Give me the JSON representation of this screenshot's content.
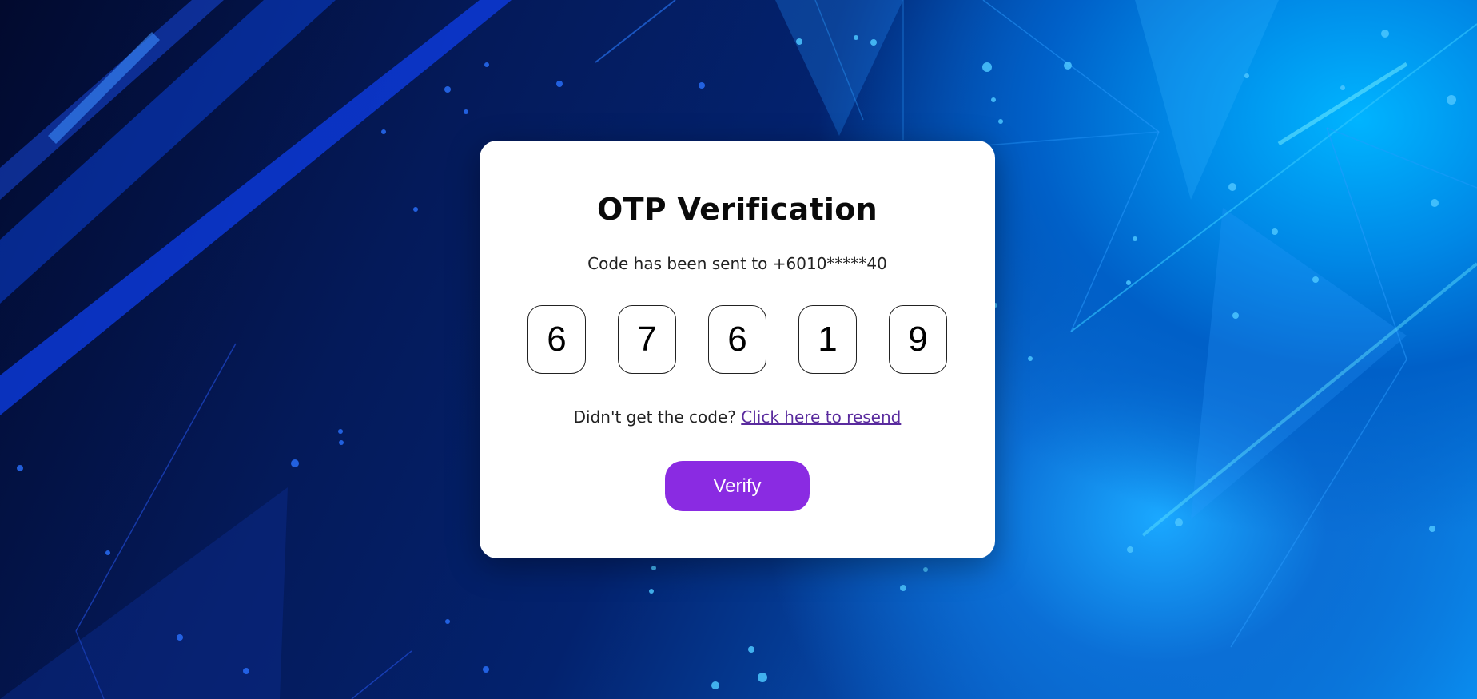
{
  "app": {
    "title": "OTP Verification"
  },
  "card": {
    "title": "OTP Verification",
    "subtitle": "Code has been sent to +6010*****40",
    "otp_digits": [
      "6",
      "7",
      "6",
      "1",
      "9"
    ],
    "resend_prompt": "Didn't get the code?",
    "resend_link": "Click here to resend",
    "verify_label": "Verify"
  },
  "colors": {
    "accent": "#8a2be2",
    "link": "#5a2b9e",
    "background_dark": "#041a5a",
    "background_light": "#0a8ef0"
  }
}
